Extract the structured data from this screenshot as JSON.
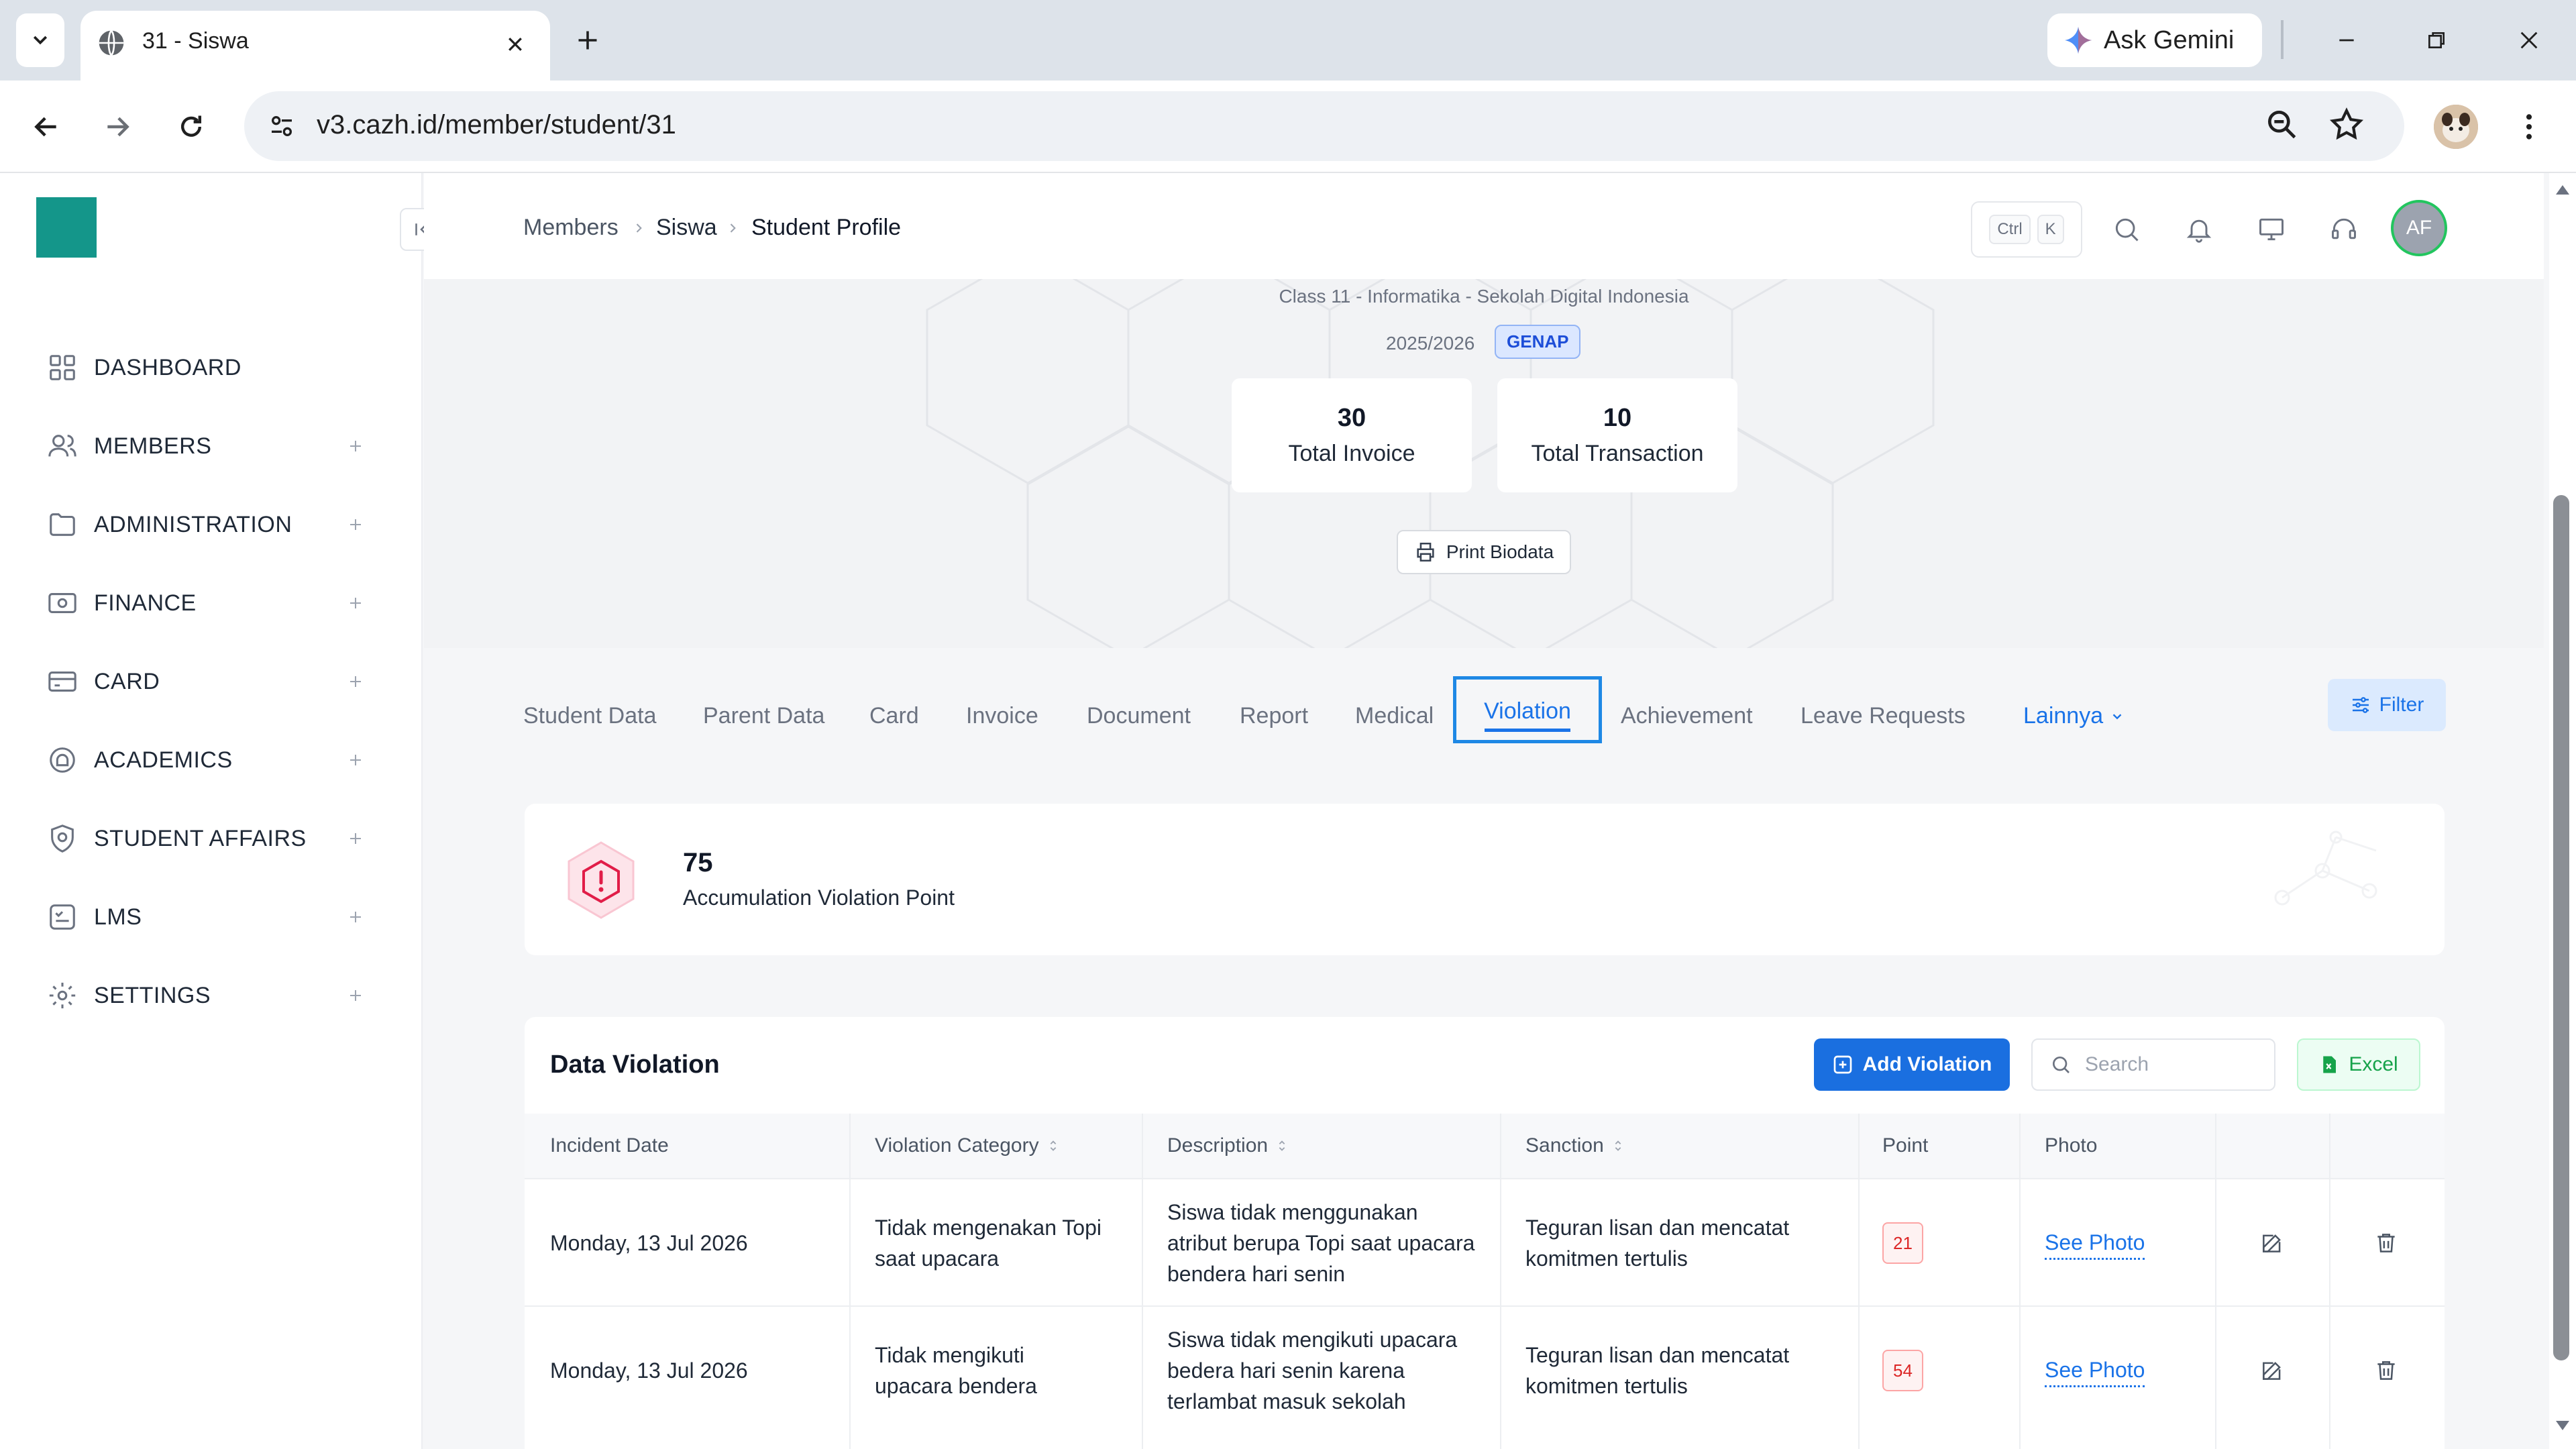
{
  "browser": {
    "tab_title": "31 - Siswa",
    "url": "v3.cazh.id/member/student/31",
    "gemini_label": "Ask Gemini"
  },
  "sidebar": {
    "items": [
      {
        "label": "DASHBOARD",
        "icon": "grid-icon",
        "expandable": false
      },
      {
        "label": "MEMBERS",
        "icon": "users-icon",
        "expandable": true
      },
      {
        "label": "ADMINISTRATION",
        "icon": "folder-icon",
        "expandable": true
      },
      {
        "label": "FINANCE",
        "icon": "money-icon",
        "expandable": true
      },
      {
        "label": "CARD",
        "icon": "card-icon",
        "expandable": true
      },
      {
        "label": "ACADEMICS",
        "icon": "academics-icon",
        "expandable": true
      },
      {
        "label": "STUDENT AFFAIRS",
        "icon": "student-affairs-icon",
        "expandable": true
      },
      {
        "label": "LMS",
        "icon": "lms-icon",
        "expandable": true
      },
      {
        "label": "SETTINGS",
        "icon": "gear-icon",
        "expandable": true
      }
    ]
  },
  "header": {
    "breadcrumb": [
      "Members",
      "Siswa",
      "Student Profile"
    ],
    "shortcut_keys": [
      "Ctrl",
      "K"
    ],
    "avatar_initials": "AF"
  },
  "profile": {
    "class_info": "Class 11 - Informatika - Sekolah Digital Indonesia",
    "year": "2025/2026",
    "semester": "GENAP",
    "stats": [
      {
        "value": "30",
        "label": "Total Invoice"
      },
      {
        "value": "10",
        "label": "Total Transaction"
      }
    ],
    "print_label": "Print Biodata"
  },
  "tabs": {
    "items": [
      "Student Data",
      "Parent Data",
      "Card",
      "Invoice",
      "Document",
      "Report",
      "Medical",
      "Violation",
      "Achievement",
      "Leave Requests"
    ],
    "active": "Violation",
    "more_label": "Lainnya",
    "filter_label": "Filter"
  },
  "accumulation": {
    "value": "75",
    "label": "Accumulation Violation Point"
  },
  "violations": {
    "title": "Data Violation",
    "add_label": "Add Violation",
    "search_placeholder": "Search",
    "excel_label": "Excel",
    "columns": [
      "Incident Date",
      "Violation Category",
      "Description",
      "Sanction",
      "Point",
      "Photo"
    ],
    "rows": [
      {
        "date": "Monday, 13 Jul 2026",
        "category": "Tidak mengenakan Topi saat upacara",
        "description": "Siswa tidak menggunakan atribut berupa Topi saat upacara bendera hari senin",
        "sanction": "Teguran lisan dan mencatat komitmen tertulis",
        "point": "21",
        "photo_label": "See Photo"
      },
      {
        "date": "Monday, 13 Jul 2026",
        "category": "Tidak mengikuti upacara bendera",
        "description": "Siswa tidak mengikuti upacara bedera hari senin karena terlambat masuk sekolah",
        "sanction": "Teguran lisan dan mencatat komitmen tertulis",
        "point": "54",
        "photo_label": "See Photo"
      }
    ]
  },
  "colors": {
    "brand_teal": "#14968a",
    "primary_blue": "#1a73e8",
    "danger_red": "#dc2626",
    "excel_green": "#16a34a"
  }
}
